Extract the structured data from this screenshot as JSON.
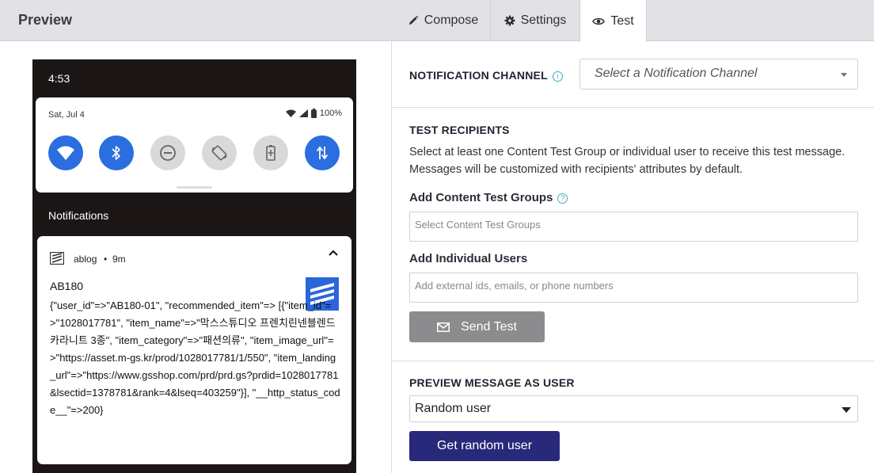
{
  "header": {
    "title": "Preview",
    "tabs": [
      {
        "label": "Compose",
        "icon": "pencil-icon"
      },
      {
        "label": "Settings",
        "icon": "gear-icon"
      },
      {
        "label": "Test",
        "icon": "eye-icon",
        "active": true
      }
    ]
  },
  "phone": {
    "time": "4:53",
    "quick_settings": {
      "date": "Sat, Jul 4",
      "battery": "100%",
      "tiles": [
        {
          "icon": "wifi-icon",
          "on": true
        },
        {
          "icon": "bluetooth-icon",
          "on": true
        },
        {
          "icon": "do-not-disturb-icon",
          "on": false
        },
        {
          "icon": "auto-rotate-icon",
          "on": false
        },
        {
          "icon": "battery-saver-icon",
          "on": false
        },
        {
          "icon": "mobile-data-icon",
          "on": true
        }
      ]
    },
    "notifications_label": "Notifications",
    "notification": {
      "app_name": "ablog",
      "dot": "•",
      "time": "9m",
      "title": "AB180",
      "body": "{\"user_id\"=>\"AB180-01\", \"recommended_item\"=> [{\"item_id\"=>\"1028017781\", \"item_name\"=>\"막스스튜디오 프렌치린넨블렌드 카라니트 3종\", \"item_category\"=>\"패션의류\", \"item_image_url\"=>\"https://asset.m-gs.kr/prod/1028017781/1/550\", \"item_landing_url\"=>\"https://www.gsshop.com/prd/prd.gs?prdid=1028017781&lsectid=1378781&rank=4&lseq=403259\"}], \"__http_status_code__\"=>200}"
    }
  },
  "form": {
    "channel": {
      "label": "NOTIFICATION CHANNEL",
      "info": "i",
      "placeholder": "Select a Notification Channel"
    },
    "recipients": {
      "label": "TEST RECIPIENTS",
      "description": "Select at least one Content Test Group or individual user to receive this test message. Messages will be customized with recipients' attributes by default.",
      "groups_label": "Add Content Test Groups",
      "groups_info": "?",
      "groups_placeholder": "Select Content Test Groups",
      "users_label": "Add Individual Users",
      "users_placeholder": "Add external ids, emails, or phone numbers",
      "send_button": "Send Test"
    },
    "preview_as_user": {
      "label": "PREVIEW MESSAGE AS USER",
      "selected": "Random user",
      "button": "Get random user"
    }
  },
  "colors": {
    "header_bg": "#e2e2e6",
    "tile_on": "#2a6ee0",
    "send_button": "#8c8c8f",
    "primary_button": "#28297a",
    "info_icon": "#41a8c4"
  }
}
